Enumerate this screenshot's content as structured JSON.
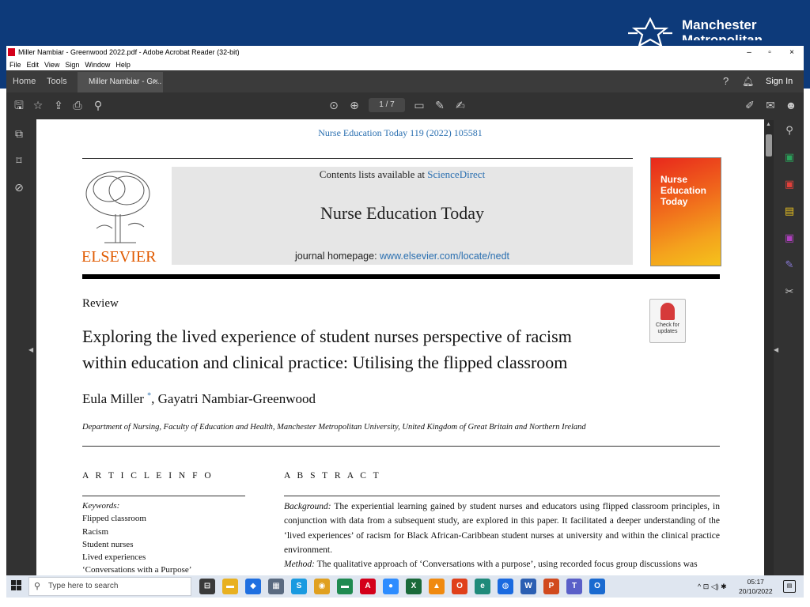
{
  "slide": {
    "logo_line1": "Manchester",
    "logo_line2": "Metropolitan"
  },
  "window": {
    "title": "Miller Nambiar - Greenwood 2022.pdf - Adobe Acrobat Reader (32-bit)",
    "controls": [
      "–",
      "▫",
      "×"
    ],
    "menu": [
      "File",
      "Edit",
      "View",
      "Sign",
      "Window",
      "Help"
    ]
  },
  "tabs": {
    "home": "Home",
    "tools": "Tools",
    "doc": "Miller Nambiar - Gr...",
    "close": "×",
    "sign_in": "Sign In"
  },
  "toolbar": {
    "page_current": "1",
    "page_total": "/ 7",
    "icons_left": [
      "save-icon",
      "star-icon",
      "upload-icon",
      "print-icon",
      "zoom-icon"
    ],
    "icons_center": [
      "page-up-icon",
      "page-down-icon",
      "comment-icon",
      "pen-icon",
      "sign-icon"
    ],
    "icons_right": [
      "fill-sign-icon",
      "email-icon",
      "user-icon"
    ]
  },
  "document": {
    "journal_ref": "Nurse Education Today 119 (2022) 105581",
    "contents_prefix": "Contents lists available at ",
    "contents_link": "ScienceDirect",
    "journal_name": "Nurse Education Today",
    "homepage_prefix": "journal homepage: ",
    "homepage_url": "www.elsevier.com/locate/nedt",
    "publisher": "ELSEVIER",
    "cover_text_1": "Nurse",
    "cover_text_2": "Education",
    "cover_text_3": "Today",
    "check_updates": "Check for updates",
    "article_type": "Review",
    "title_line1": "Exploring the lived experience of student nurses perspective of racism",
    "title_line2": "within education and clinical practice: Utilising the flipped classroom",
    "author_1": "Eula Miller",
    "author_mark": "*",
    "author_2": ", Gayatri Nambiar-Greenwood",
    "affiliation": "Department of Nursing, Faculty of Education and Health, Manchester Metropolitan University, United Kingdom of Great Britain and Northern Ireland",
    "article_info_head": "A R T I C L E   I N F O",
    "abstract_head": "A B S T R A C T",
    "keywords_head": "Keywords:",
    "keywords": [
      "Flipped classroom",
      "Racism",
      "Student nurses",
      "Lived experiences",
      "‘Conversations with a Purpose’"
    ],
    "bg_label": "Background:",
    "bg_text": " The experiential learning gained by student nurses and educators using flipped classroom principles, in conjunction with data from a subsequent study, are explored in this paper. It facilitated a deeper understanding of the ‘lived experiences’ of racism for Black African-Caribbean student nurses at university and within the clinical practice environment.",
    "method_label": "Method:",
    "method_text": " The qualitative approach of ‘Conversations with a purpose’, using recorded focus group discussions was"
  },
  "taskbar": {
    "search_placeholder": "Type here to search",
    "time": "05:17",
    "date": "20/10/2022",
    "apps": [
      {
        "name": "task-view-icon",
        "color": "#3a3a3a",
        "glyph": "⊟"
      },
      {
        "name": "file-explorer-icon",
        "color": "#e8b020",
        "glyph": "▬"
      },
      {
        "name": "dropbox-icon",
        "color": "#1f6fe0",
        "glyph": "◆"
      },
      {
        "name": "calculator-icon",
        "color": "#5a6a80",
        "glyph": "▦"
      },
      {
        "name": "skype-icon",
        "color": "#1a9ae0",
        "glyph": "S"
      },
      {
        "name": "chrome-icon",
        "color": "#e0a020",
        "glyph": "◉"
      },
      {
        "name": "green-app-icon",
        "color": "#1f8a50",
        "glyph": "▬"
      },
      {
        "name": "acrobat-icon",
        "color": "#d4001a",
        "glyph": "A"
      },
      {
        "name": "zoom-app-icon",
        "color": "#2d8cff",
        "glyph": "●"
      },
      {
        "name": "xbox-icon",
        "color": "#1a6a3a",
        "glyph": "X"
      },
      {
        "name": "vlc-icon",
        "color": "#f08a10",
        "glyph": "▲"
      },
      {
        "name": "office-icon",
        "color": "#e0401a",
        "glyph": "O"
      },
      {
        "name": "edge-icon",
        "color": "#1f8a7a",
        "glyph": "e"
      },
      {
        "name": "globe-icon",
        "color": "#1a6ae0",
        "glyph": "◍"
      },
      {
        "name": "word-icon",
        "color": "#2b5fb3",
        "glyph": "W"
      },
      {
        "name": "powerpoint-icon",
        "color": "#d14a1e",
        "glyph": "P"
      },
      {
        "name": "teams-icon",
        "color": "#5a5fc8",
        "glyph": "T"
      },
      {
        "name": "outlook-icon",
        "color": "#1a6ad0",
        "glyph": "O"
      }
    ],
    "tray_text": "^ ⊡ ◁) ✱"
  }
}
